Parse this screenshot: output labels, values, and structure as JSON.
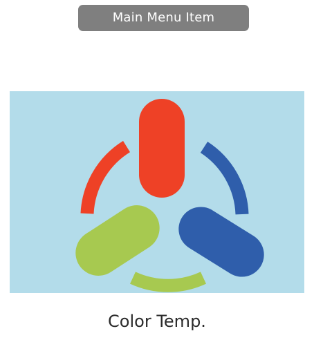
{
  "menu_item": {
    "label": "Main Menu Item"
  },
  "feature": {
    "caption": "Color Temp.",
    "icon": "color-temperature-icon"
  },
  "colors": {
    "menu_pill": "#7f7f7f",
    "menu_text": "#ffffff",
    "panel_background": "#b3dcea",
    "red": "#ee4126",
    "blue": "#2f5eab",
    "green": "#a7c950",
    "caption_text": "#2b2b2b"
  }
}
